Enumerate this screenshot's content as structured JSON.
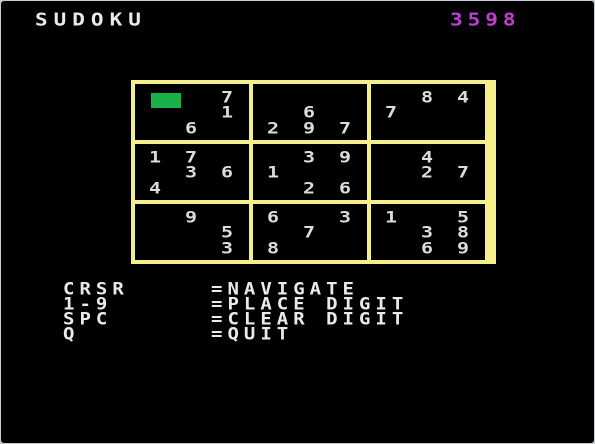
{
  "title": "SUDOKU",
  "score": "3598",
  "colors": {
    "background": "#000000",
    "grid": "#f2ef8c",
    "digits": "#dcdcdc",
    "score": "#c03ed0",
    "cursor": "#19b24a",
    "text": "#eaeaea"
  },
  "board": {
    "boxes": [
      {
        "rows": [
          [
            "",
            "",
            "7"
          ],
          [
            "",
            "",
            "1"
          ],
          [
            "",
            "6",
            ""
          ]
        ],
        "cursor": true
      },
      {
        "rows": [
          [
            "",
            "",
            ""
          ],
          [
            "",
            "6",
            ""
          ],
          [
            "2",
            "9",
            "7"
          ]
        ]
      },
      {
        "rows": [
          [
            "",
            "8",
            "4"
          ],
          [
            "7",
            "",
            ""
          ],
          [
            "",
            "",
            ""
          ]
        ]
      },
      {
        "rows": [
          [
            "1",
            "7",
            ""
          ],
          [
            "",
            "3",
            "6"
          ],
          [
            "4",
            "",
            ""
          ]
        ]
      },
      {
        "rows": [
          [
            "",
            "3",
            "9"
          ],
          [
            "1",
            "",
            ""
          ],
          [
            "",
            "2",
            "6"
          ]
        ]
      },
      {
        "rows": [
          [
            "",
            "4",
            ""
          ],
          [
            "",
            "2",
            "7"
          ],
          [
            "",
            "",
            ""
          ]
        ]
      },
      {
        "rows": [
          [
            "",
            "9",
            ""
          ],
          [
            "",
            "",
            "5"
          ],
          [
            "",
            "",
            "3"
          ]
        ]
      },
      {
        "rows": [
          [
            "6",
            "",
            "3"
          ],
          [
            "",
            "7",
            ""
          ],
          [
            "8",
            "",
            ""
          ]
        ]
      },
      {
        "rows": [
          [
            "1",
            "",
            "5"
          ],
          [
            "",
            "3",
            "8"
          ],
          [
            "",
            "6",
            "9"
          ]
        ]
      }
    ]
  },
  "help": [
    {
      "key": "CRSR",
      "action": "=NAVIGATE"
    },
    {
      "key": "1-9",
      "action": "=PLACE DIGIT"
    },
    {
      "key": "SPC",
      "action": "=CLEAR DIGIT"
    },
    {
      "key": "Q",
      "action": "=QUIT"
    }
  ]
}
